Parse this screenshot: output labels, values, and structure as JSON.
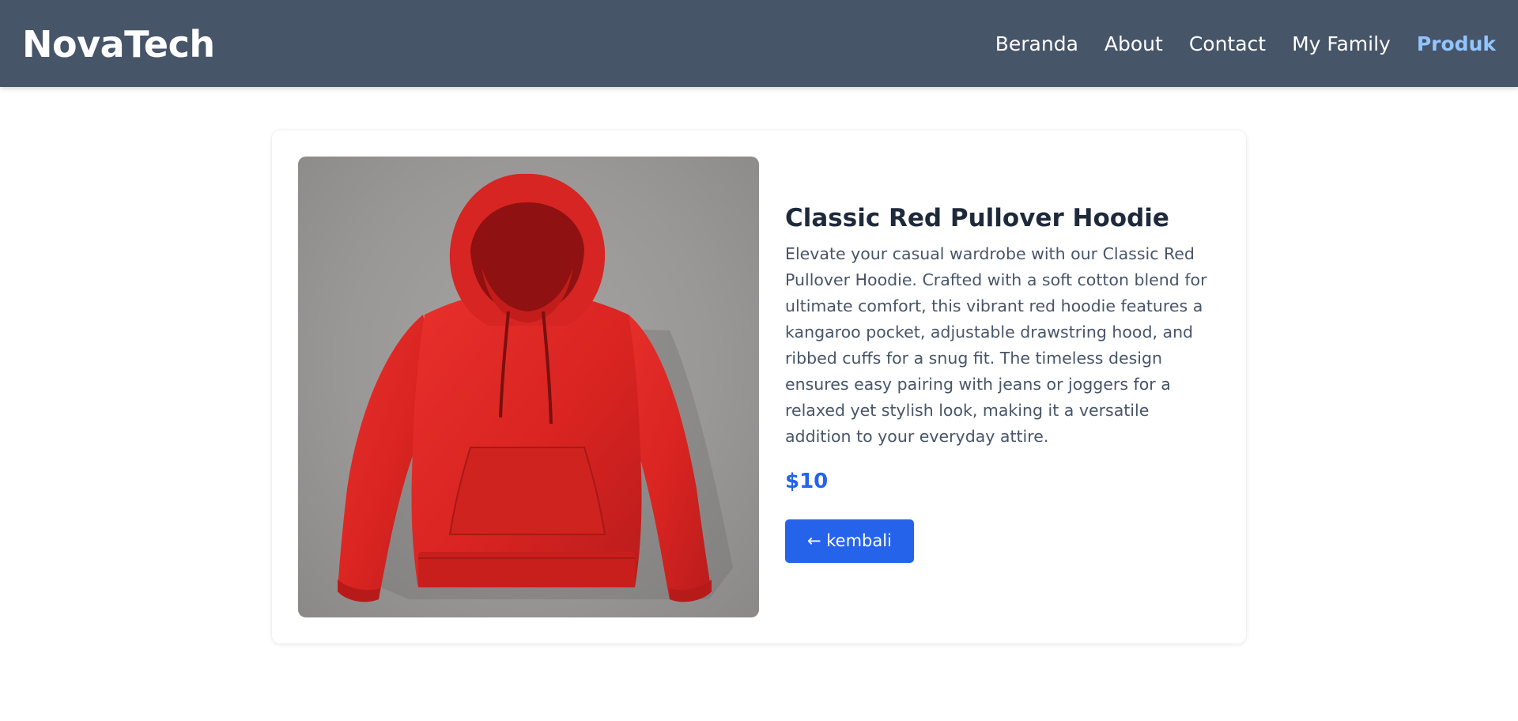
{
  "brand": "NovaTech",
  "nav": {
    "items": [
      {
        "label": "Beranda"
      },
      {
        "label": "About"
      },
      {
        "label": "Contact"
      },
      {
        "label": "My Family"
      },
      {
        "label": "Produk"
      }
    ],
    "active": "Produk"
  },
  "product": {
    "title": "Classic Red Pullover Hoodie",
    "description": "Elevate your casual wardrobe with our Classic Red Pullover Hoodie. Crafted with a soft cotton blend for ultimate comfort, this vibrant red hoodie features a kangaroo pocket, adjustable drawstring hood, and ribbed cuffs for a snug fit. The timeless design ensures easy pairing with jeans or joggers for a relaxed yet stylish look, making it a versatile addition to your everyday attire.",
    "price": "$10",
    "back_label": "← kembali",
    "image_icon": "red-hoodie-photo"
  },
  "colors": {
    "navbar": "#475569",
    "active_link": "#93c5fd",
    "accent": "#2563eb",
    "hoodie": "#dc2626"
  }
}
